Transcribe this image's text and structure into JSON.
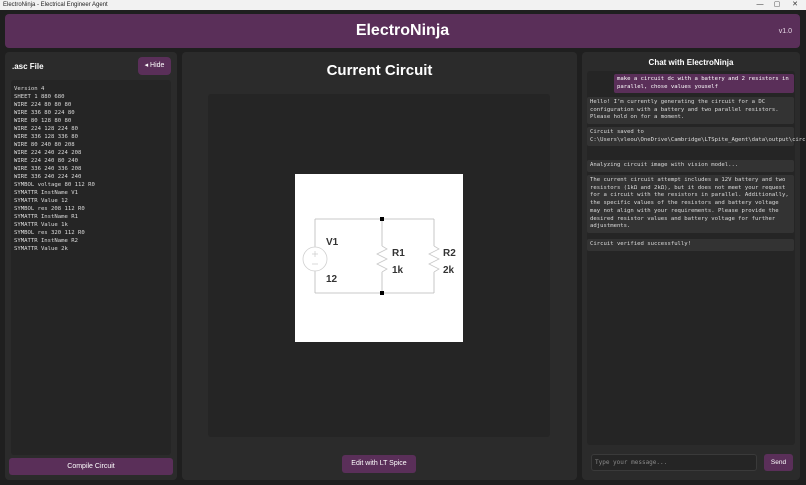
{
  "window": {
    "title": "ElectroNinja - Electrical Engineer Agent",
    "controls": {
      "minimize": "—",
      "maximize": "▢",
      "close": "✕"
    }
  },
  "header": {
    "title": "ElectroNinja",
    "version": "v1.0"
  },
  "left_panel": {
    "title": ".asc File",
    "hide_label": "Hide",
    "hide_icon": "◂",
    "code_lines": [
      "Version 4",
      "SHEET 1 880 680",
      "WIRE 224 80 80 80",
      "WIRE 336 80 224 80",
      "WIRE 80 128 80 80",
      "WIRE 224 128 224 80",
      "WIRE 336 128 336 80",
      "WIRE 80 240 80 208",
      "WIRE 224 240 224 208",
      "WIRE 224 240 80 240",
      "WIRE 336 240 336 208",
      "WIRE 336 240 224 240",
      "SYMBOL voltage 80 112 R0",
      "SYMATTR InstName V1",
      "SYMATTR Value 12",
      "SYMBOL res 208 112 R0",
      "SYMATTR InstName R1",
      "SYMATTR Value 1k",
      "SYMBOL res 320 112 R0",
      "SYMATTR InstName R2",
      "SYMATTR Value 2k"
    ],
    "compile_label": "Compile Circuit"
  },
  "center_panel": {
    "title": "Current Circuit",
    "circuit": {
      "v1_name": "V1",
      "v1_value": "12",
      "r1_name": "R1",
      "r1_value": "1k",
      "r2_name": "R2",
      "r2_value": "2k"
    },
    "edit_label": "Edit with LT Spice"
  },
  "chat": {
    "title": "Chat with ElectroNinja",
    "messages": [
      {
        "role": "user",
        "text": "make a circuit dc with a battery and 2 resistors in parallel, chose values youself"
      },
      {
        "role": "bot",
        "text": "Hello! I’m currently generating the circuit for a DC configuration with a battery and two parallel resistors. Please hold on for a moment."
      },
      {
        "role": "bot",
        "text": "Circuit saved to C:\\Users\\vleou\\OneDrive\\Cambridge\\LTSpite_Agent\\data\\output\\circuit.asc"
      },
      {
        "role": "bot",
        "text": "Analyzing circuit image with vision model..."
      },
      {
        "role": "bot",
        "text": "The current circuit attempt includes a 12V battery and two resistors (1kΩ and 2kΩ), but it does not meet your request for a circuit with the resistors in parallel. Additionally, the specific values of the resistors and battery voltage may not align with your requirements. Please provide the desired resistor values and battery voltage for further adjustments."
      },
      {
        "role": "bot",
        "text": "Circuit verified successfully!"
      }
    ],
    "input_placeholder": "Type your message...",
    "send_label": "Send"
  }
}
